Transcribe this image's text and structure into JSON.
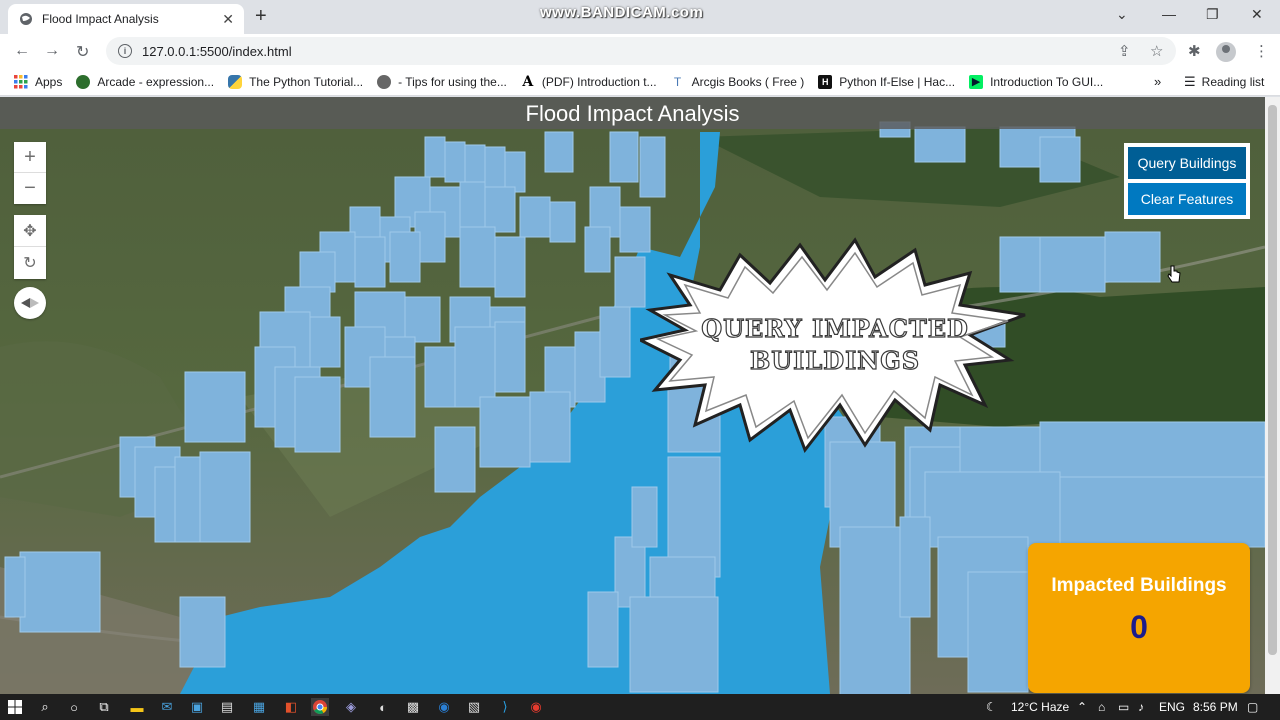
{
  "watermark": "www.BANDICAM.com",
  "browser": {
    "tab_title": "Flood Impact Analysis",
    "new_tab": "+",
    "url": "127.0.0.1:5500/index.html",
    "bookmarks": [
      {
        "label": "Apps",
        "icon": "apps-grid-icon"
      },
      {
        "label": "Arcade - expression...",
        "icon": "globe-icon"
      },
      {
        "label": "The Python Tutorial...",
        "icon": "python-icon"
      },
      {
        "label": "- Tips for using the...",
        "icon": "globe-icon"
      },
      {
        "label": "(PDF) Introduction t...",
        "icon": "academia-icon"
      },
      {
        "label": "Arcgis Books ( Free )",
        "icon": "tz-icon"
      },
      {
        "label": "Python If-Else | Hac...",
        "icon": "hackerrank-icon"
      },
      {
        "label": "Introduction To GUI...",
        "icon": "datacamp-icon"
      }
    ],
    "more_bookmarks": "»",
    "reading_list": "Reading list"
  },
  "app": {
    "title": "Flood Impact Analysis",
    "zoom_in": "+",
    "zoom_out": "−",
    "query_button": "Query Buildings",
    "clear_button": "Clear Features",
    "callout_line1": "QUERY IMPACTED",
    "callout_line2": "BUILDINGS",
    "impacted_label": "Impacted Buildings",
    "impacted_count": "0",
    "colors": {
      "water": "#2b9fd9",
      "building": "#7fb3dc",
      "panel": "#f5a500",
      "button": "#0079c1"
    }
  },
  "taskbar": {
    "weather": "12°C  Haze",
    "language": "ENG",
    "time": "8:56 PM"
  }
}
